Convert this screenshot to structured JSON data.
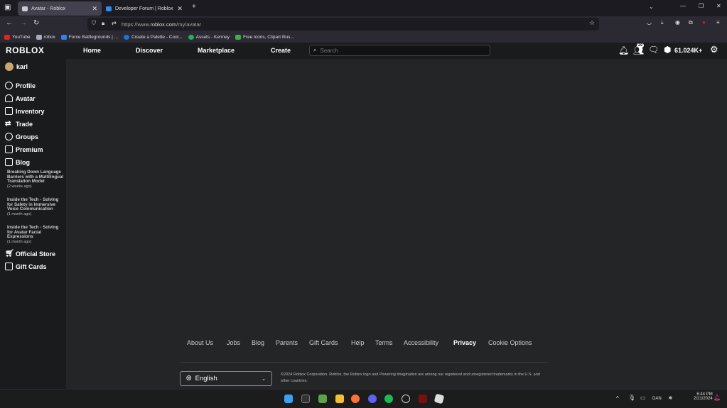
{
  "browser": {
    "tabs": [
      {
        "title": "Avatar - Roblox",
        "active": true
      },
      {
        "title": "Developer Forum | Roblox",
        "active": false
      }
    ],
    "url_prefix": "https://www.",
    "url_domain": "roblox.com",
    "url_path": "/my/avatar",
    "bookmarks": [
      {
        "label": "YouTube",
        "color": "#e62117"
      },
      {
        "label": "robox",
        "color": "#aab"
      },
      {
        "label": "Force Battlegrounds | ...",
        "color": "#2d7ff9"
      },
      {
        "label": "Create a Palette - Cool...",
        "color": "#1a73e8"
      },
      {
        "label": "Assets - Kenney",
        "color": "#27ae60"
      },
      {
        "label": "Free Icons, Clipart Illus...",
        "color": "#3cb043"
      }
    ]
  },
  "header": {
    "logo": "ROBLOX",
    "nav": [
      "Home",
      "Discover",
      "Marketplace",
      "Create"
    ],
    "search_placeholder": "Search",
    "friend_requests": "29",
    "robux": "61.024K+"
  },
  "sidebar": {
    "username": "karl",
    "items": [
      "Profile",
      "Avatar",
      "Inventory",
      "Trade",
      "Groups",
      "Premium",
      "Blog"
    ],
    "blog_posts": [
      {
        "title": "Breaking Down Language Barriers with a Multilingual Translation Model",
        "age": "(2 weeks ago)"
      },
      {
        "title": "Inside the Tech - Solving for Safety in Immersive Voice Communication",
        "age": "(1 month ago)"
      },
      {
        "title": "Inside the Tech - Solving for Avatar Facial Expressions",
        "age": "(1 month ago)"
      }
    ],
    "bottom_items": [
      "Official Store",
      "Gift Cards"
    ]
  },
  "footer": {
    "links": [
      "About Us",
      "Jobs",
      "Blog",
      "Parents",
      "Gift Cards",
      "Help",
      "Terms",
      "Accessibility",
      "Privacy",
      "Cookie Options"
    ],
    "language": "English",
    "copyright": "©2024 Roblox Corporation. Roblox, the Roblox logo and Powering Imagination are among our registered and unregistered trademarks in the U.S. and other countries."
  },
  "taskbar": {
    "lang": "DAN",
    "time": "6:44 PM",
    "date": "2/21/2024"
  }
}
